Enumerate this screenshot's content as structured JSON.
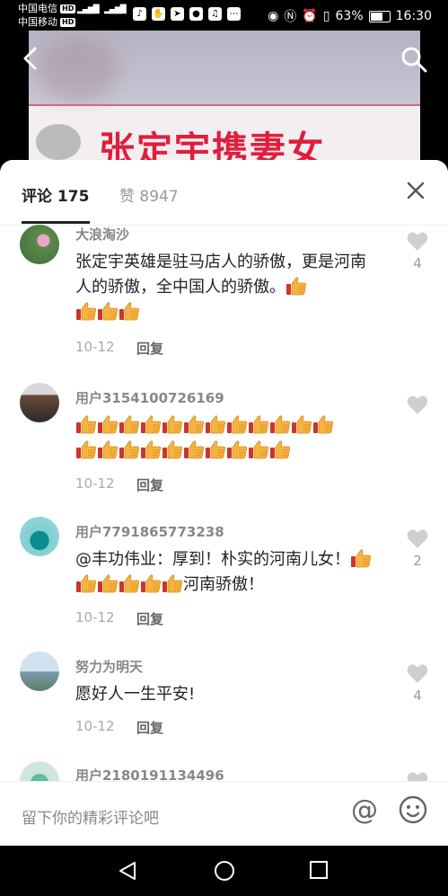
{
  "status_bar": {
    "carrier1": "中国电信",
    "carrier2": "中国移动",
    "hd": "HD",
    "battery_level": "63%",
    "battery_fill": 0.63,
    "time": "16:30"
  },
  "video": {
    "title_text": "张定宇携妻女"
  },
  "tabs": {
    "comments_label": "评论 175",
    "likes_label": "赞 8947"
  },
  "comments": [
    {
      "username": "大浪淘沙",
      "text": "张定宇英雄是驻马店人的骄傲，更是河南人的骄傲，全中国人的骄傲。",
      "date": "10-12",
      "reply": "回复",
      "likes": "4"
    },
    {
      "username": "用户3154100726169",
      "text": "",
      "date": "10-12",
      "reply": "回复",
      "likes": ""
    },
    {
      "username": "用户7791865773238",
      "text_part1": "@丰功伟业：厚到！朴实的河南儿女！",
      "text_part2": "河南骄傲！",
      "date": "10-12",
      "reply": "回复",
      "likes": "2"
    },
    {
      "username": "努力为明天",
      "text": "愿好人一生平安!",
      "date": "10-12",
      "reply": "回复",
      "likes": "4"
    },
    {
      "username": "用户2180191134496"
    }
  ],
  "input": {
    "placeholder": "留下你的精彩评论吧",
    "at_symbol": "@"
  },
  "colors": {
    "video_title": "#e01e3c",
    "like_gray": "#cccccc",
    "text_primary": "#222222",
    "text_secondary": "#888888"
  },
  "icons": [
    "back-icon",
    "search-icon",
    "close-icon",
    "heart-icon",
    "thumbs-up-emoji",
    "at-icon",
    "emoji-icon",
    "nav-back-icon",
    "nav-home-icon",
    "nav-recent-icon"
  ]
}
